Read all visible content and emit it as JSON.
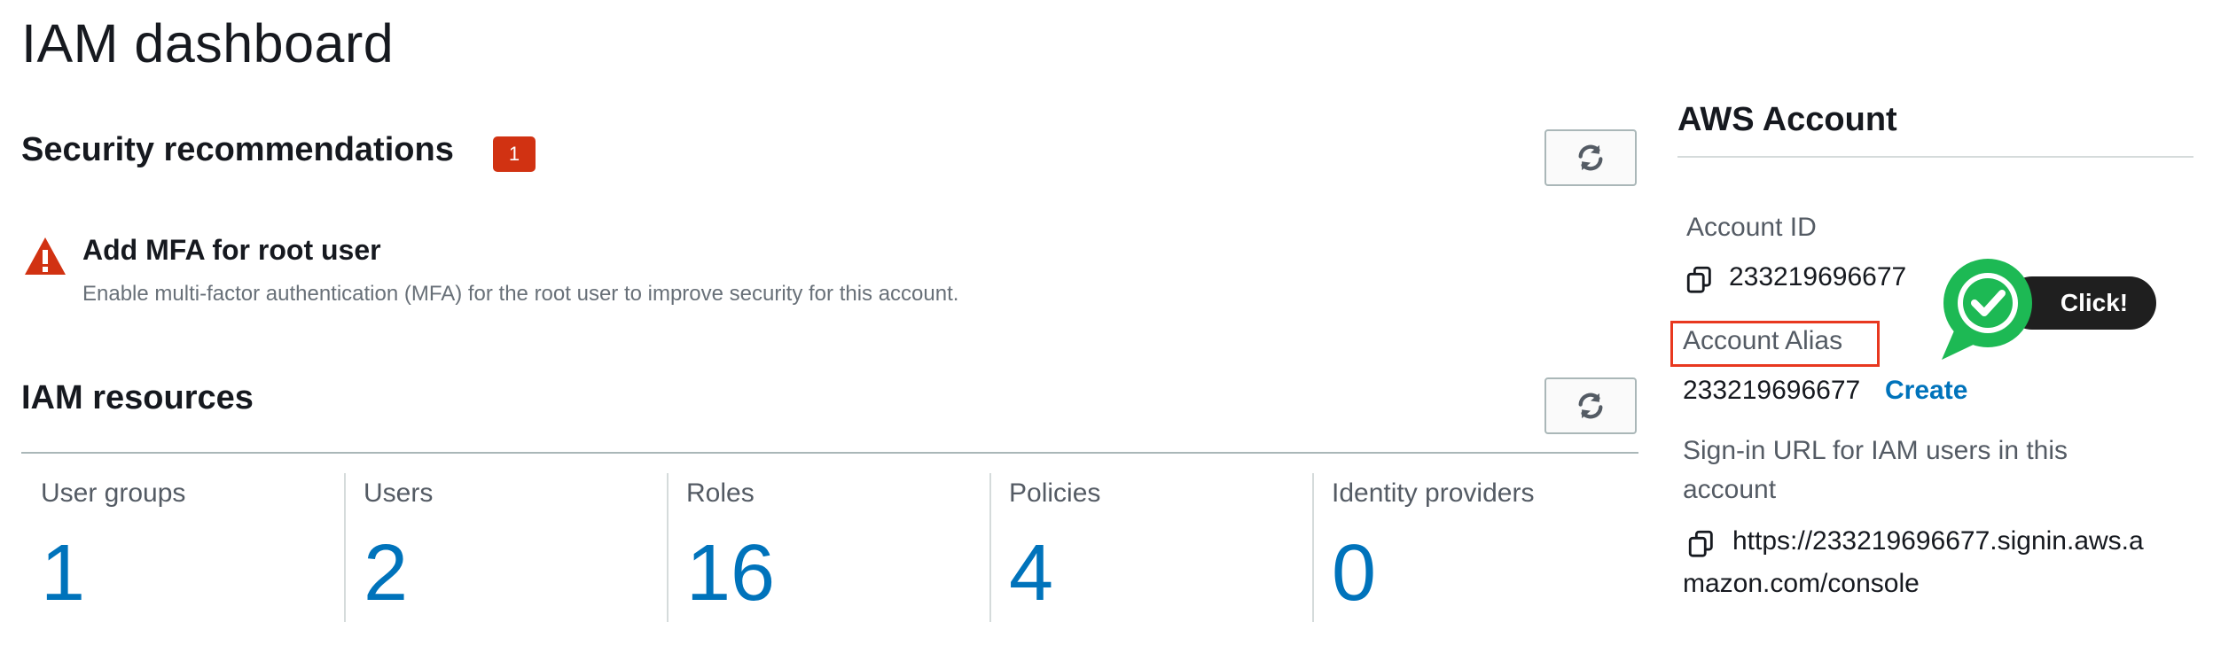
{
  "page": {
    "title": "IAM dashboard"
  },
  "security": {
    "title": "Security recommendations",
    "badge_count": "1",
    "recommendation": {
      "title": "Add MFA for root user",
      "description": "Enable multi-factor authentication (MFA) for the root user to improve security for this account."
    }
  },
  "resources": {
    "title": "IAM resources",
    "items": [
      {
        "label": "User groups",
        "count": "1"
      },
      {
        "label": "Users",
        "count": "2"
      },
      {
        "label": "Roles",
        "count": "16"
      },
      {
        "label": "Policies",
        "count": "4"
      },
      {
        "label": "Identity providers",
        "count": "0"
      }
    ]
  },
  "account": {
    "title": "AWS Account",
    "id_label": "Account ID",
    "id_value": "233219696677",
    "alias_label": "Account Alias",
    "alias_value": "233219696677",
    "create_label": "Create",
    "signin_label_line1": "Sign-in URL for IAM users in this",
    "signin_label_line2": "account",
    "signin_url_line1": "https://233219696677.signin.aws.a",
    "signin_url_line2": "mazon.com/console"
  },
  "annotation": {
    "click_label": "Click!"
  },
  "colors": {
    "link": "#0073bb",
    "badge": "#d13212",
    "highlight": "#e8381f",
    "check": "#1db954"
  },
  "icons": [
    "warning-icon",
    "refresh-icon",
    "copy-icon",
    "checkmark-icon"
  ]
}
